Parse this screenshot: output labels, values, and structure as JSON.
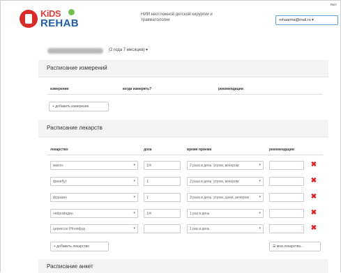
{
  "header": {
    "logo_kids": "KiDS",
    "logo_rehab": "REHAB",
    "org_name": "НИИ неотложной детской хирургии и травматологии",
    "top_link": "вых",
    "user_email": "rehaarma@mail.ru ▾"
  },
  "patient": {
    "age": "(2 года 7 месяцев) ▾"
  },
  "measurements": {
    "title": "Расписание измерений",
    "columns": [
      "измерение",
      "когда измерять?",
      "рекомендации"
    ],
    "add_label": "+ добавить измерение"
  },
  "medications": {
    "title": "Расписание лекарств",
    "columns": [
      "лекарство",
      "доза",
      "время приема",
      "рекомендации"
    ],
    "rows": [
      {
        "drug": "кватос",
        "dose": "1/4",
        "schedule": "2 раза в день: утром, вечером"
      },
      {
        "drug": "финибут",
        "dose": "1",
        "schedule": "2 раза в день: утром, вечером"
      },
      {
        "drug": "фуразин",
        "dose": "1",
        "schedule": "3 раза в день: утром, днем, вечером"
      },
      {
        "drug": "нейромидин",
        "dose": "1/4",
        "schedule": "1 раз в день"
      },
      {
        "drug": "церексон (Ноопфуд",
        "dose": "",
        "schedule": "1 раз в день"
      }
    ],
    "add_label": "+ добавить лекарство",
    "my_drugs_label": "☰ мои лекарства..."
  },
  "questionnaires": {
    "title": "Расписание анкет"
  },
  "colors": {
    "accent_border": "#5b9bd5",
    "delete": "#e02020"
  }
}
